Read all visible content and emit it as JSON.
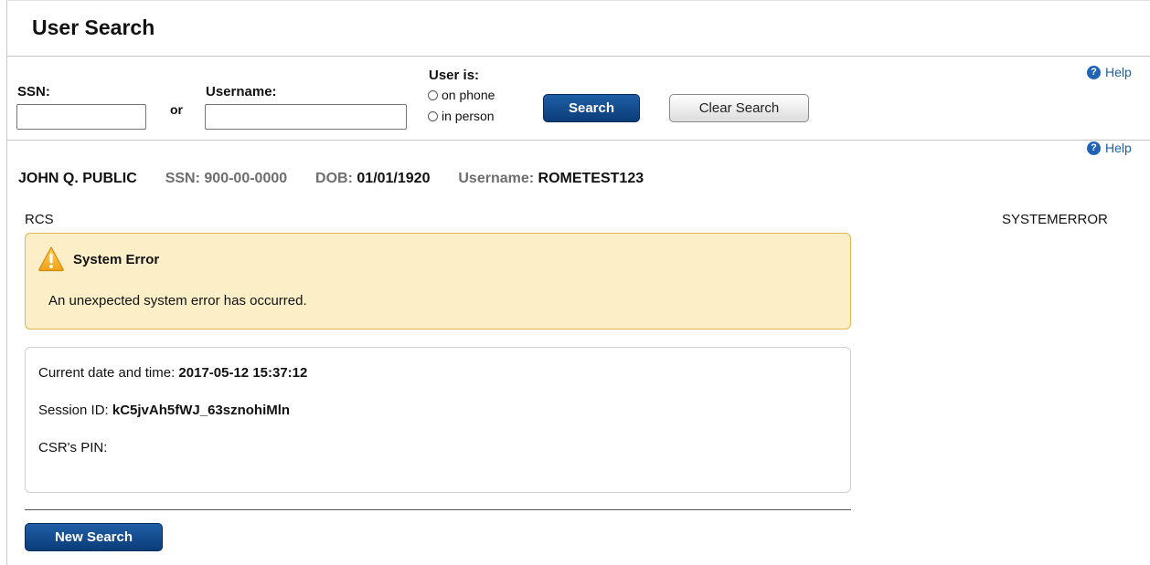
{
  "page": {
    "title": "User Search"
  },
  "search_form": {
    "ssn_label": "SSN:",
    "ssn_value": "",
    "or_label": "or",
    "username_label": "Username:",
    "username_value": "",
    "user_is_label": "User is:",
    "radio_options": [
      "on phone",
      "in person"
    ],
    "search_button": "Search",
    "clear_button": "Clear Search",
    "help_label": "Help"
  },
  "user_info": {
    "name": "JOHN Q. PUBLIC",
    "ssn_label": "SSN:",
    "ssn_value": "900-00-0000",
    "dob_label": "DOB:",
    "dob_value": "01/01/1920",
    "username_label": "Username:",
    "username_value": "ROMETEST123",
    "help_label": "Help"
  },
  "context": {
    "left_label": "RCS",
    "right_code": "SYSTEMERROR"
  },
  "alert": {
    "title": "System Error",
    "message": "An unexpected system error has occurred."
  },
  "details": {
    "datetime_label": "Current date and time:",
    "datetime_value": "2017-05-12 15:37:12",
    "session_label": "Session ID:",
    "session_value": "kC5jvAh5fWJ_63sznohiMln",
    "pin_label": "CSR's PIN:",
    "pin_value": ""
  },
  "actions": {
    "new_search_button": "New Search"
  },
  "colors": {
    "primary_button": "#0b3c79",
    "alert_background": "#fcefc8",
    "alert_border": "#e0b74c",
    "help_link": "#1f5fa6",
    "warning_icon": "#f0a818"
  }
}
